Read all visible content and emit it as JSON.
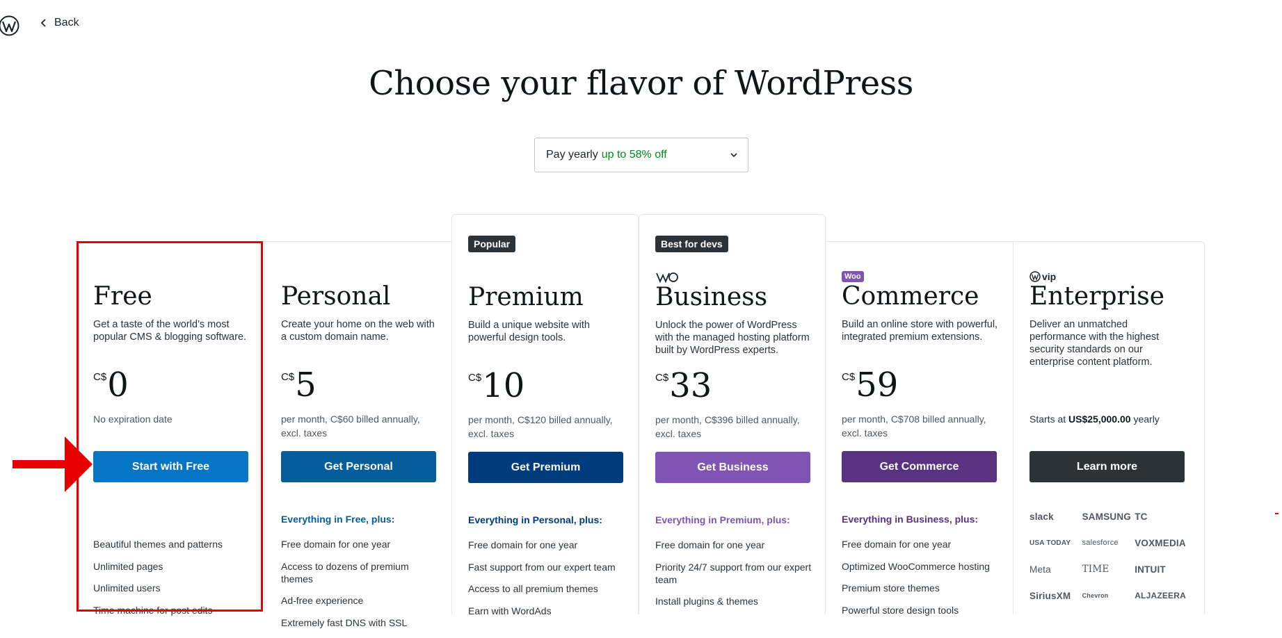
{
  "nav": {
    "back_label": "Back"
  },
  "title": "Choose your flavor of WordPress",
  "billing_select": {
    "label": "Pay yearly",
    "discount": "up to 58% off"
  },
  "colors": {
    "free_btn": "#0675c4",
    "personal_btn": "#055d9c",
    "premium_btn": "#003c7d",
    "business_btn": "#7f54b3",
    "commerce_btn": "#593382",
    "enterprise_btn": "#2c3338",
    "highlight": "#e80000"
  },
  "plans": [
    {
      "name": "Free",
      "desc": "Get a taste of the world’s most popular CMS & blogging software.",
      "currency": "C$",
      "price": "0",
      "billing": "No expiration date",
      "cta": "Start with Free",
      "features_head": "",
      "features": [
        "Beautiful themes and patterns",
        "Unlimited pages",
        "Unlimited users",
        "Time machine for post edits"
      ]
    },
    {
      "name": "Personal",
      "desc": "Create your home on the web with a custom domain name.",
      "currency": "C$",
      "price": "5",
      "billing": "per month, C$60 billed annually, excl. taxes",
      "cta": "Get Personal",
      "features_head": "Everything in Free, plus:",
      "features": [
        "Free domain for one year",
        "Access to dozens of premium themes",
        "Ad-free experience",
        "Extremely fast DNS with SSL"
      ]
    },
    {
      "name": "Premium",
      "badge": "Popular",
      "desc": "Build a unique website with powerful design tools.",
      "currency": "C$",
      "price": "10",
      "billing": "per month, C$120 billed annually, excl. taxes",
      "cta": "Get Premium",
      "features_head": "Everything in Personal, plus:",
      "features": [
        "Free domain for one year",
        "Fast support from our expert team",
        "Access to all premium themes",
        "Earn with WordAds"
      ]
    },
    {
      "name": "Business",
      "badge": "Best for devs",
      "desc": "Unlock the power of WordPress with the managed hosting platform built by WordPress experts.",
      "currency": "C$",
      "price": "33",
      "billing": "per month, C$396 billed annually, excl. taxes",
      "cta": "Get Business",
      "features_head": "Everything in Premium, plus:",
      "features": [
        "Free domain for one year",
        "Priority 24/7 support from our expert team",
        "Install plugins & themes"
      ]
    },
    {
      "name": "Commerce",
      "brand": "Woo",
      "desc": "Build an online store with powerful, integrated premium extensions.",
      "currency": "C$",
      "price": "59",
      "billing": "per month, C$708 billed annually, excl. taxes",
      "cta": "Get Commerce",
      "features_head": "Everything in Business, plus:",
      "features": [
        "Free domain for one year",
        "Optimized WooCommerce hosting",
        "Premium store themes",
        "Powerful store design tools"
      ]
    },
    {
      "name": "Enterprise",
      "brand": "vip",
      "desc": "Deliver an unmatched performance with the highest security standards on our enterprise content platform.",
      "billing_prefix": "Starts at",
      "billing_amount": "US$25,000.00",
      "billing_suffix": "yearly",
      "cta": "Learn more",
      "logos": [
        "slack",
        "SAMSUNG",
        "TC",
        "USA TODAY",
        "salesforce",
        "VOXMEDIA",
        "Meta",
        "TIME",
        "INTUIT",
        "SiriusXM",
        "Chevron",
        "ALJAZEERA"
      ]
    }
  ]
}
